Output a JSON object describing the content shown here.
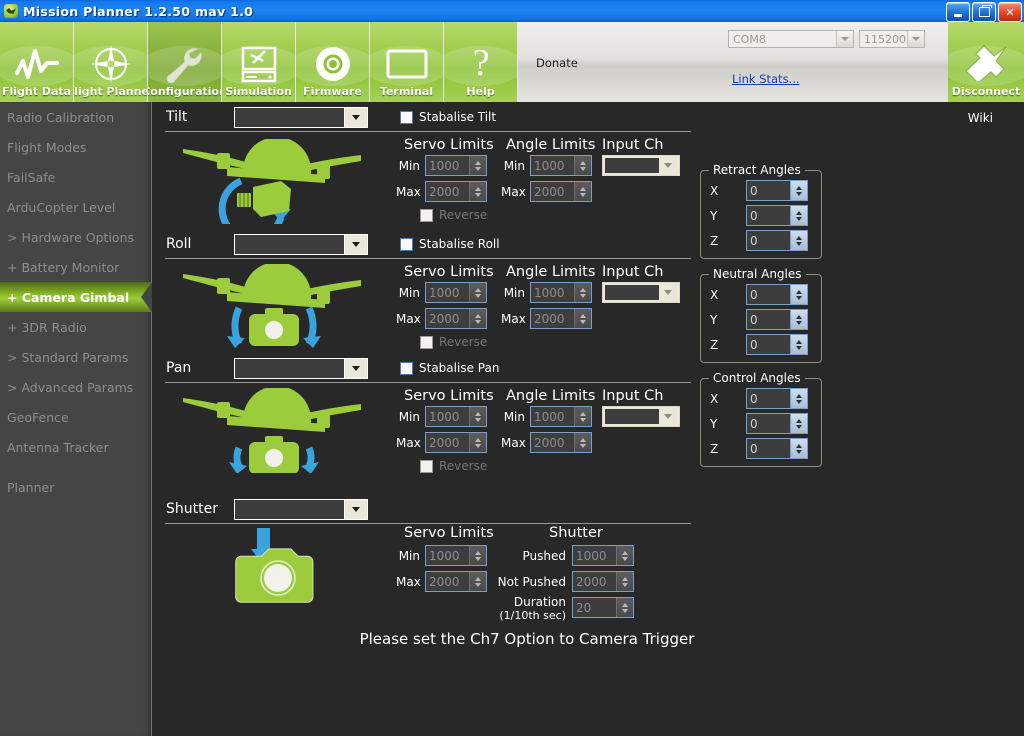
{
  "window": {
    "title": "Mission Planner 1.2.50 mav 1.0",
    "icon": "app-icon",
    "minimize_label": "_",
    "maximize_label": "❐",
    "close_label": "✕"
  },
  "toolbar": {
    "buttons": [
      {
        "label": "Flight Data",
        "icon": "waveform-icon",
        "active": false
      },
      {
        "label": "Flight Planner",
        "icon": "crosshair-icon",
        "active": false
      },
      {
        "label": "Configuration",
        "icon": "wrench-icon",
        "active": true
      },
      {
        "label": "Simulation",
        "icon": "monitor-plane-icon",
        "active": false
      },
      {
        "label": "Firmware",
        "icon": "disc-icon",
        "active": false
      },
      {
        "label": "Terminal",
        "icon": "screen-icon",
        "active": false
      },
      {
        "label": "Help",
        "icon": "question-mark-icon",
        "active": false
      }
    ],
    "donate_label": "Donate",
    "link_stats_label": "Link Stats...",
    "com_port": "COM8",
    "baud_rate": "115200",
    "disconnect_label": "Disconnect",
    "disconnect_icon": "connector-plug-icon"
  },
  "sidebar": {
    "items": [
      {
        "label": "Radio Calibration",
        "selected": false
      },
      {
        "label": "Flight Modes",
        "selected": false
      },
      {
        "label": "FailSafe",
        "selected": false
      },
      {
        "label": "ArduCopter Level",
        "selected": false
      },
      {
        "label": "> Hardware Options",
        "selected": false
      },
      {
        "label": "+ Battery Monitor",
        "selected": false
      },
      {
        "label": "+ Camera Gimbal",
        "selected": true
      },
      {
        "label": "+ 3DR Radio",
        "selected": false
      },
      {
        "label": "> Standard Params",
        "selected": false
      },
      {
        "label": "> Advanced Params",
        "selected": false
      },
      {
        "label": "GeoFence",
        "selected": false
      },
      {
        "label": "Antenna Tracker",
        "selected": false
      },
      {
        "label": "Planner",
        "selected": false
      }
    ]
  },
  "main": {
    "wiki_label": "Wiki",
    "col_servo_limits": "Servo Limits",
    "col_angle_limits": "Angle Limits",
    "col_input_ch": "Input Ch",
    "col_shutter": "Shutter",
    "lbl_min": "Min",
    "lbl_max": "Max",
    "lbl_reverse": "Reverse",
    "hint": "Please set the Ch7 Option to Camera Trigger",
    "axes": [
      {
        "name": "Tilt",
        "axis_label": "Tilt",
        "type_value": "",
        "stabilise_label": "Stabalise Tilt",
        "stabilise_checked": false,
        "icon": "quadcopter-tilt-icon",
        "servo_min": "1000",
        "servo_max": "2000",
        "angle_min": "1000",
        "angle_max": "2000",
        "input_ch": "",
        "reverse_checked": false
      },
      {
        "name": "Roll",
        "axis_label": "Roll",
        "type_value": "",
        "stabilise_label": "Stabalise Roll",
        "stabilise_checked": false,
        "icon": "quadcopter-roll-icon",
        "servo_min": "1000",
        "servo_max": "2000",
        "angle_min": "1000",
        "angle_max": "2000",
        "input_ch": "",
        "reverse_checked": false
      },
      {
        "name": "Pan",
        "axis_label": "Pan",
        "type_value": "",
        "stabilise_label": "Stabalise Pan",
        "stabilise_checked": false,
        "icon": "quadcopter-pan-icon",
        "servo_min": "1000",
        "servo_max": "2000",
        "angle_min": "1000",
        "angle_max": "2000",
        "input_ch": "",
        "reverse_checked": false
      }
    ],
    "shutter": {
      "axis_label": "Shutter",
      "type_value": "",
      "icon": "camera-trigger-icon",
      "servo_min": "1000",
      "servo_max": "2000",
      "pushed_label": "Pushed",
      "pushed_value": "1000",
      "not_pushed_label": "Not Pushed",
      "not_pushed_value": "2000",
      "duration_label_1": "Duration",
      "duration_label_2": "(1/10th sec)",
      "duration_value": "20"
    },
    "angle_groups": [
      {
        "title": "Retract Angles",
        "rows": [
          {
            "axis": "X",
            "value": "0"
          },
          {
            "axis": "Y",
            "value": "0"
          },
          {
            "axis": "Z",
            "value": "0"
          }
        ]
      },
      {
        "title": "Neutral Angles",
        "rows": [
          {
            "axis": "X",
            "value": "0"
          },
          {
            "axis": "Y",
            "value": "0"
          },
          {
            "axis": "Z",
            "value": "0"
          }
        ]
      },
      {
        "title": "Control Angles",
        "rows": [
          {
            "axis": "X",
            "value": "0"
          },
          {
            "axis": "Y",
            "value": "0"
          },
          {
            "axis": "Z",
            "value": "0"
          }
        ]
      }
    ]
  },
  "colors": {
    "brand_green": "#8cc134",
    "title_blue": "#1379ef",
    "sidebar_bg": "#454545",
    "main_bg": "#282828",
    "accent_blue": "#3aa3dd"
  }
}
